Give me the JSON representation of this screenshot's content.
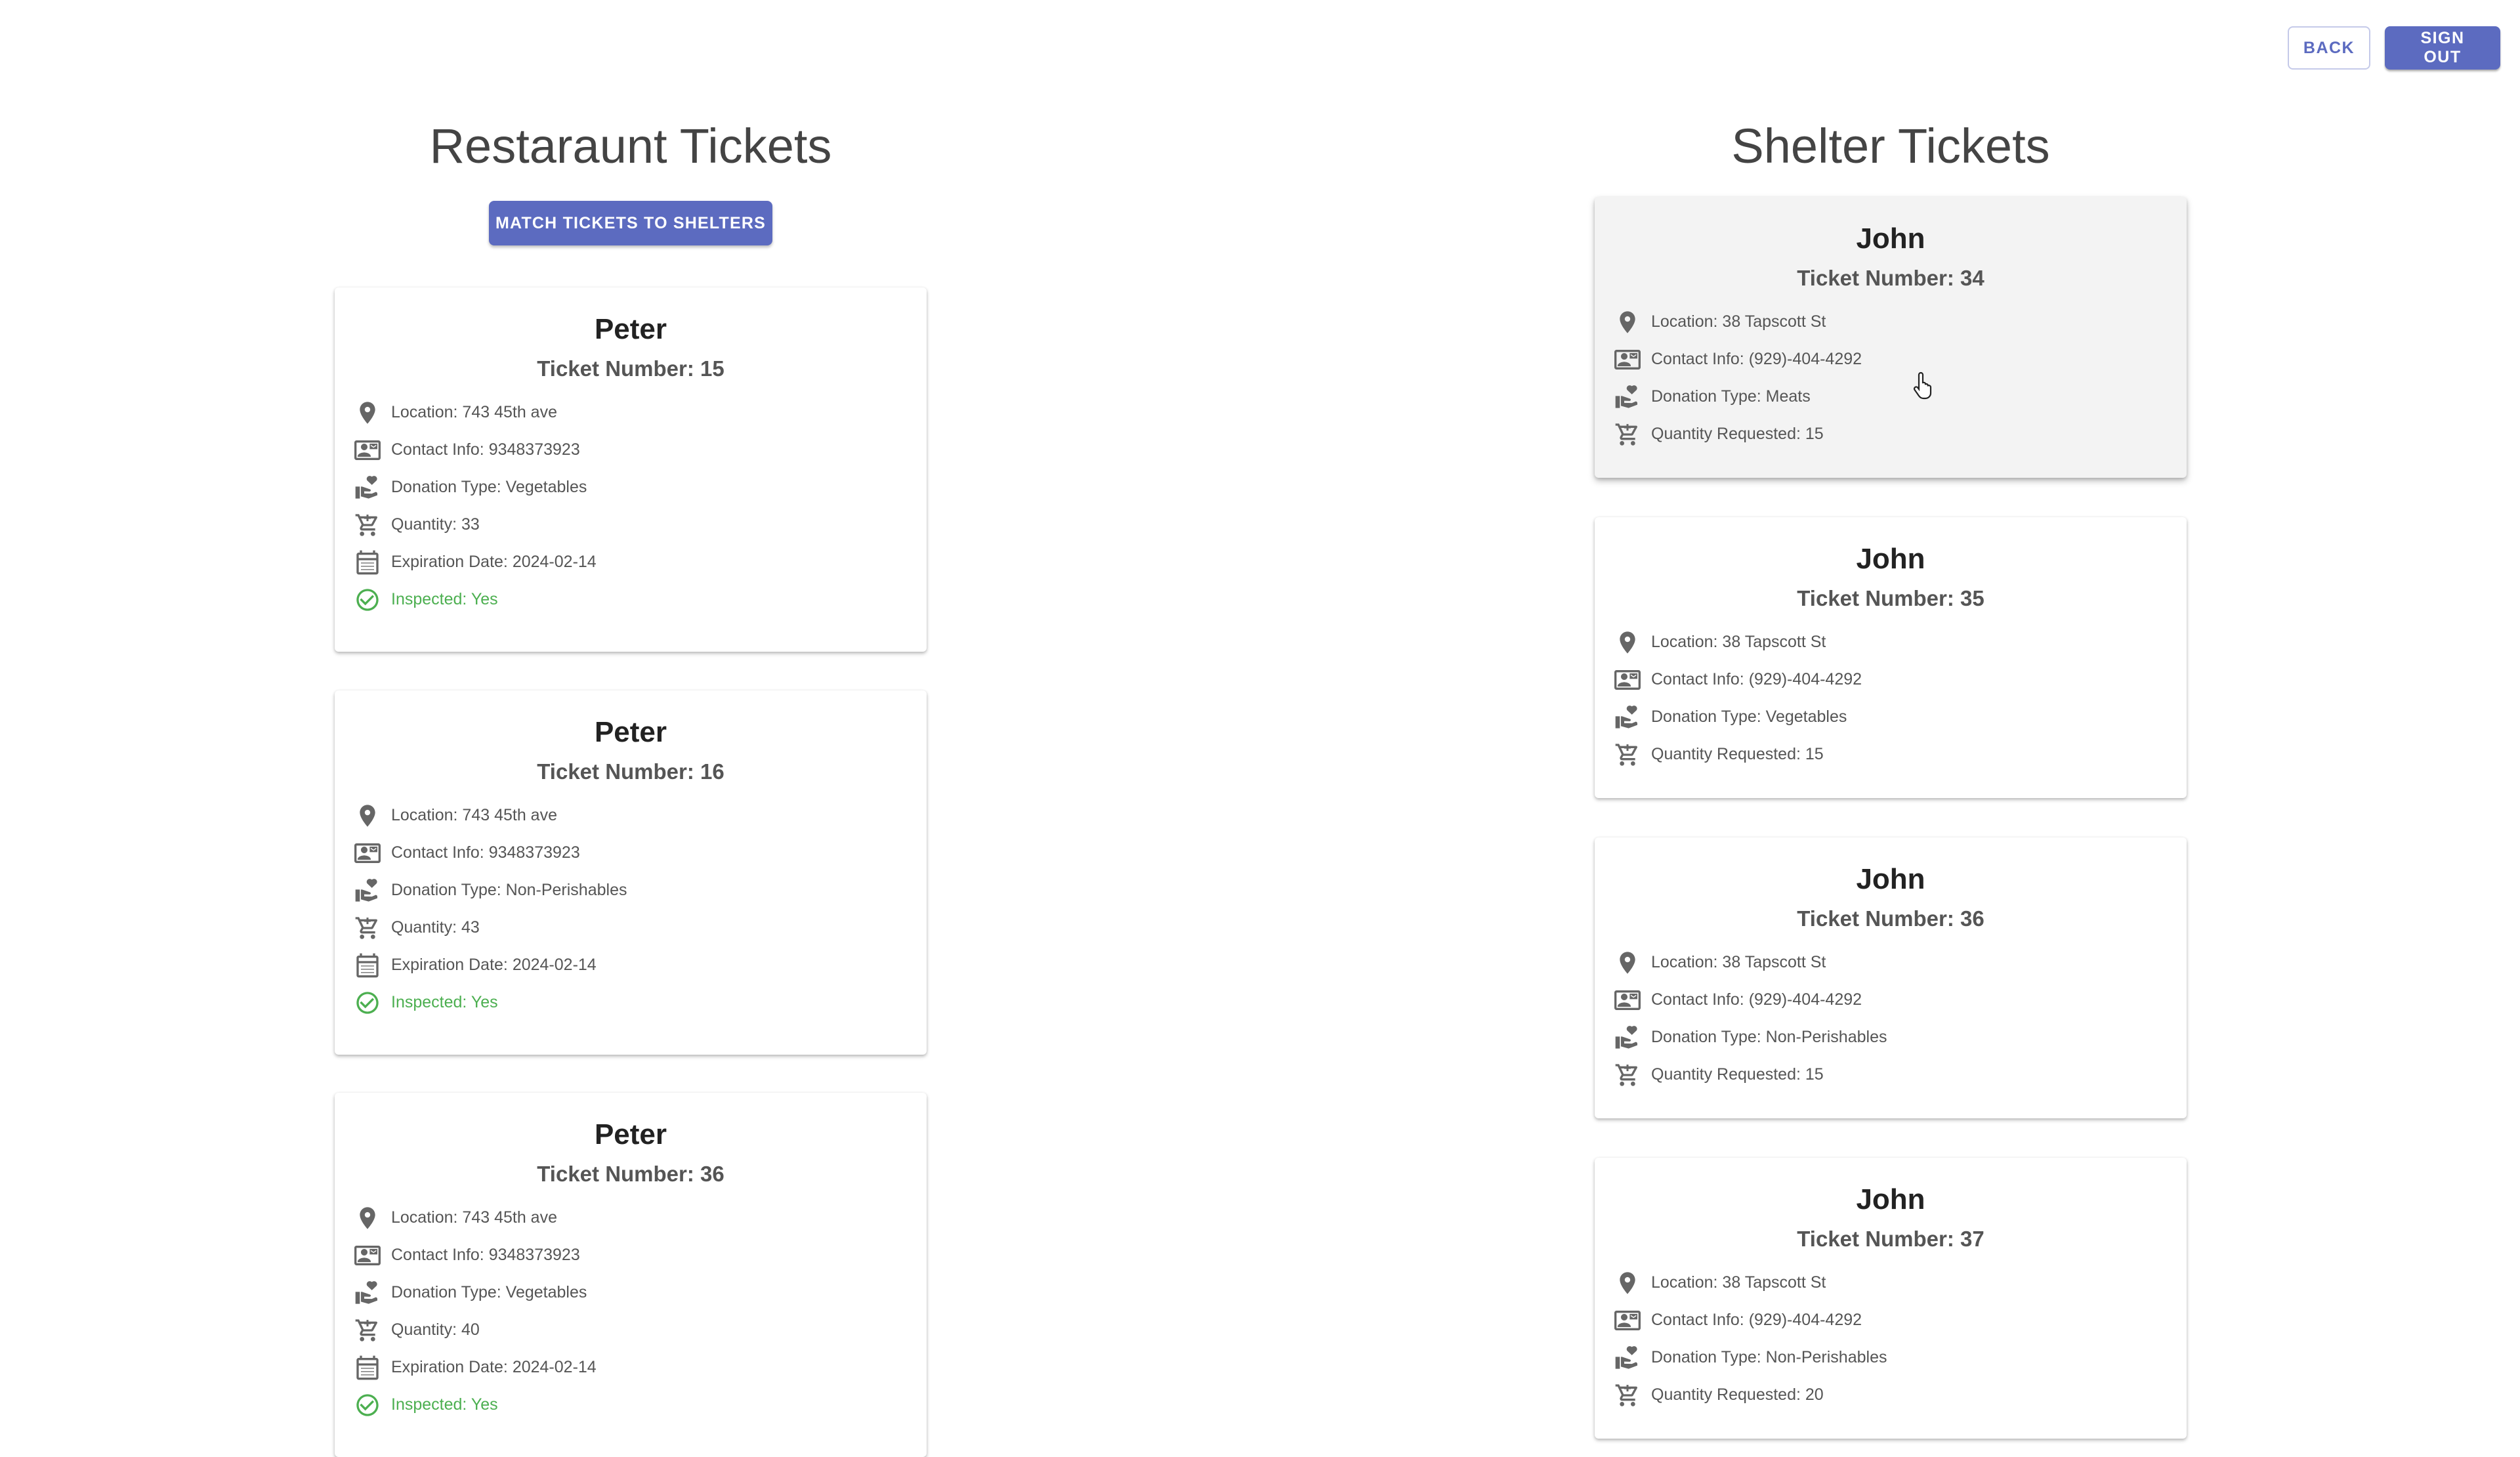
{
  "toolbar": {
    "back_label": "BACK",
    "signout_label": "SIGN OUT"
  },
  "restaurant": {
    "title": "Restaraunt Tickets",
    "match_label": "MATCH TICKETS TO SHELTERS",
    "cards": [
      {
        "name": "Peter",
        "ticket": "Ticket Number: 15",
        "location": "Location: 743 45th ave",
        "contact": "Contact Info: 9348373923",
        "donation": "Donation Type: Vegetables",
        "quantity": "Quantity: 33",
        "expiration": "Expiration Date: 2024-02-14",
        "inspected": "Inspected: Yes"
      },
      {
        "name": "Peter",
        "ticket": "Ticket Number: 16",
        "location": "Location: 743 45th ave",
        "contact": "Contact Info: 9348373923",
        "donation": "Donation Type: Non-Perishables",
        "quantity": "Quantity: 43",
        "expiration": "Expiration Date: 2024-02-14",
        "inspected": "Inspected: Yes"
      },
      {
        "name": "Peter",
        "ticket": "Ticket Number: 36",
        "location": "Location: 743 45th ave",
        "contact": "Contact Info: 9348373923",
        "donation": "Donation Type: Vegetables",
        "quantity": "Quantity: 40",
        "expiration": "Expiration Date: 2024-02-14",
        "inspected": "Inspected: Yes"
      }
    ]
  },
  "shelter": {
    "title": "Shelter Tickets",
    "cards": [
      {
        "name": "John",
        "ticket": "Ticket Number: 34",
        "location": "Location: 38 Tapscott St",
        "contact": "Contact Info: (929)-404-4292",
        "donation": "Donation Type: Meats",
        "quantity": "Quantity Requested: 15"
      },
      {
        "name": "John",
        "ticket": "Ticket Number: 35",
        "location": "Location: 38 Tapscott St",
        "contact": "Contact Info: (929)-404-4292",
        "donation": "Donation Type: Vegetables",
        "quantity": "Quantity Requested: 15"
      },
      {
        "name": "John",
        "ticket": "Ticket Number: 36",
        "location": "Location: 38 Tapscott St",
        "contact": "Contact Info: (929)-404-4292",
        "donation": "Donation Type: Non-Perishables",
        "quantity": "Quantity Requested: 15"
      },
      {
        "name": "John",
        "ticket": "Ticket Number: 37",
        "location": "Location: 38 Tapscott St",
        "contact": "Contact Info: (929)-404-4292",
        "donation": "Donation Type: Non-Perishables",
        "quantity": "Quantity Requested: 20"
      }
    ]
  },
  "icons": {
    "location": "location-pin-icon",
    "contact": "contact-card-icon",
    "donation": "volunteer-hand-icon",
    "quantity": "shopping-cart-icon",
    "expiration": "calendar-icon",
    "inspected": "check-circle-icon"
  },
  "colors": {
    "accent": "#5c6bc0",
    "success": "#4caf50",
    "text_secondary": "#555555"
  }
}
